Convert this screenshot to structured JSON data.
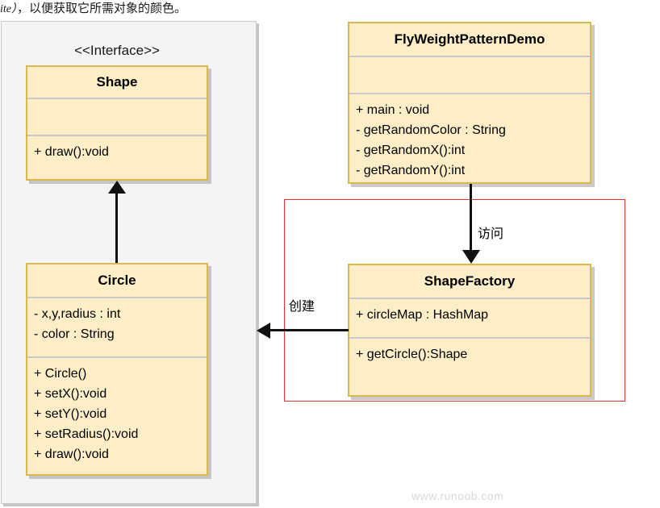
{
  "page": {
    "top_text_italic": "ite）",
    "top_text_rest": "，以便获取它所需对象的颜色。",
    "watermark": "www.runoob.com"
  },
  "diagram": {
    "interface_stereotype": "<<Interface>>",
    "classes": {
      "shape": {
        "name": "Shape",
        "attributes": [],
        "methods": [
          "+ draw():void"
        ]
      },
      "circle": {
        "name": "Circle",
        "attributes": [
          "- x,y,radius : int",
          "- color : String"
        ],
        "methods": [
          "+ Circle()",
          "+ setX():void",
          "+ setY():void",
          "+ setRadius():void",
          "+ draw():void"
        ]
      },
      "demo": {
        "name": "FlyWeightPatternDemo",
        "attributes": [],
        "methods": [
          "+ main : void",
          "- getRandomColor : String",
          "- getRandomX():int",
          "- getRandomY():int"
        ]
      },
      "factory": {
        "name": "ShapeFactory",
        "attributes": [
          "+ circleMap : HashMap"
        ],
        "methods": [
          "+ getCircle():Shape"
        ]
      }
    },
    "edges": {
      "access_label": "访问",
      "create_label": "创建"
    },
    "colors": {
      "class_fill": "#fdeec8",
      "class_border": "#dcb84e",
      "panel_fill": "#f4f4f4",
      "highlight_rect": "#e8302a",
      "connector": "#111111",
      "watermark": "#d8d8dc"
    }
  }
}
